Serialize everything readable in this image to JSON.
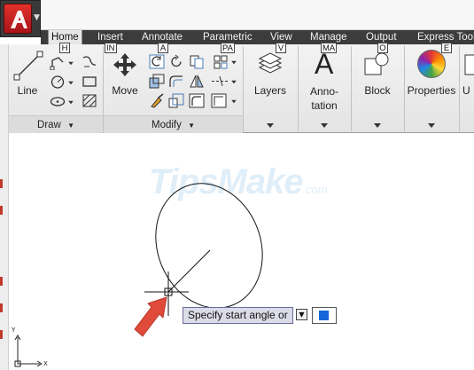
{
  "app": {
    "logo_letter": "A",
    "logo_icon": "autocad-logo-icon"
  },
  "tabs": [
    {
      "label": "Home",
      "active": true,
      "keytip": "H"
    },
    {
      "label": "Insert",
      "keytip": "IN"
    },
    {
      "label": "Annotate",
      "keytip": "A"
    },
    {
      "label": "Parametric",
      "keytip": "PA"
    },
    {
      "label": "View",
      "keytip": "V"
    },
    {
      "label": "Manage",
      "keytip": "MA"
    },
    {
      "label": "Output",
      "keytip": "O"
    },
    {
      "label": "Express Tools",
      "keytip": "E"
    }
  ],
  "ribbon": {
    "draw": {
      "group_label": "Draw",
      "line_label": "Line",
      "tools": [
        "polyline-icon",
        "circle-icon",
        "ellipse-icon",
        "spline-icon",
        "rectangle-icon",
        "hatch-icon"
      ]
    },
    "modify": {
      "group_label": "Modify",
      "move_label": "Move",
      "tools": [
        "rotate-icon",
        "trim-icon",
        "copy-icon",
        "mirror-icon",
        "fillet-icon",
        "stretch-icon",
        "scale-icon",
        "array-icon",
        "erase-icon",
        "offset-icon",
        "explode-icon"
      ]
    },
    "layers_label": "Layers",
    "annotation_label": "Anno-\ntation",
    "block_label": "Block",
    "properties_label": "Properties",
    "utilities_label": "U"
  },
  "watermark": {
    "text": "TipsMake",
    "suffix": ".com"
  },
  "command_prompt": {
    "text": "Specify start angle or",
    "options_icon": "arrow-down-icon",
    "input_value": ""
  },
  "ucs": {
    "y_label": "Y",
    "x_label": "X"
  },
  "colors": {
    "tab_bar": "#3c3c3c",
    "ribbon": "#e9e9e9",
    "app_red": "#d62d27",
    "tooltip_bg": "#dcdce8",
    "cursor_blue": "#1565d8",
    "arrow_red": "#e04a3a"
  }
}
